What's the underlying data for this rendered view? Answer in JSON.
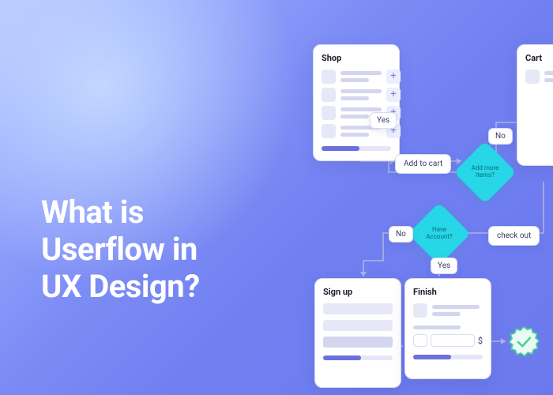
{
  "headline": {
    "line1": "What is",
    "line2": "Userflow in",
    "line3": "UX Design?"
  },
  "cards": {
    "shop": {
      "title": "Shop"
    },
    "cart": {
      "title": "Cart"
    },
    "signup": {
      "title": "Sign up"
    },
    "finish": {
      "title": "Finish",
      "currency": "$"
    }
  },
  "actions": {
    "add_to_cart": "Add to cart",
    "check_out": "check out"
  },
  "decisions": {
    "add_more": "Add more items?",
    "have_account": "Have Account?"
  },
  "branches": {
    "yes": "Yes",
    "no": "No"
  },
  "icons": {
    "plus": "+",
    "seal": "success-seal"
  },
  "colors": {
    "accent": "#6b6fe0",
    "decision": "#27d7e8",
    "seal": "#4ad29b"
  }
}
